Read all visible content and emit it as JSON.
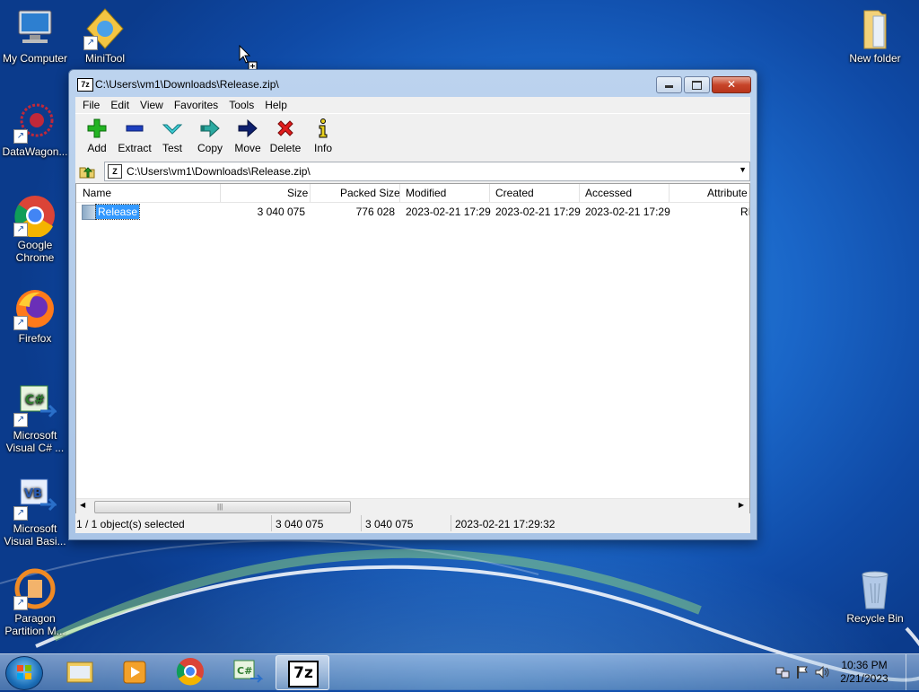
{
  "desktop": {
    "icons": [
      {
        "label": "My Computer"
      },
      {
        "label": "MiniTool"
      },
      {
        "label": "DataWagon..."
      },
      {
        "label": "Google Chrome"
      },
      {
        "label": "Firefox"
      },
      {
        "label": "Microsoft Visual C# ..."
      },
      {
        "label": "Microsoft Visual Basi..."
      },
      {
        "label": "Paragon Partition M..."
      },
      {
        "label": "New folder"
      },
      {
        "label": "Recycle Bin"
      }
    ]
  },
  "window": {
    "title": "C:\\Users\\vm1\\Downloads\\Release.zip\\",
    "app_icon": "7z",
    "close_glyph": "✕",
    "menu": [
      "File",
      "Edit",
      "View",
      "Favorites",
      "Tools",
      "Help"
    ],
    "toolbar": [
      {
        "label": "Add",
        "icon": "plus-icon"
      },
      {
        "label": "Extract",
        "icon": "minus-icon"
      },
      {
        "label": "Test",
        "icon": "check-icon"
      },
      {
        "label": "Copy",
        "icon": "copy-arrow-icon"
      },
      {
        "label": "Move",
        "icon": "move-arrow-icon"
      },
      {
        "label": "Delete",
        "icon": "x-icon"
      },
      {
        "label": "Info",
        "icon": "info-icon"
      }
    ],
    "address": "C:\\Users\\vm1\\Downloads\\Release.zip\\",
    "columns": [
      "Name",
      "Size",
      "Packed Size",
      "Modified",
      "Created",
      "Accessed",
      "Attribute"
    ],
    "rows": [
      {
        "name": "Release",
        "size": "3 040 075",
        "packed": "776 028",
        "modified": "2023-02-21 17:29",
        "created": "2023-02-21 17:29",
        "accessed": "2023-02-21 17:29",
        "attr": "RI",
        "selected": true
      }
    ],
    "status": {
      "selection": "1 / 1 object(s) selected",
      "size": "3 040 075",
      "total": "3 040 075",
      "date": "2023-02-21 17:29:32"
    }
  },
  "taskbar": {
    "items": [
      {
        "name": "file-explorer"
      },
      {
        "name": "media-player"
      },
      {
        "name": "google-chrome"
      },
      {
        "name": "visual-csharp"
      },
      {
        "name": "7zip",
        "label": "7z",
        "active": true
      }
    ],
    "time": "10:36 PM",
    "date": "2/21/2023"
  },
  "colors": {
    "selection": "#3399ff",
    "desktop": "#1a66c8"
  }
}
